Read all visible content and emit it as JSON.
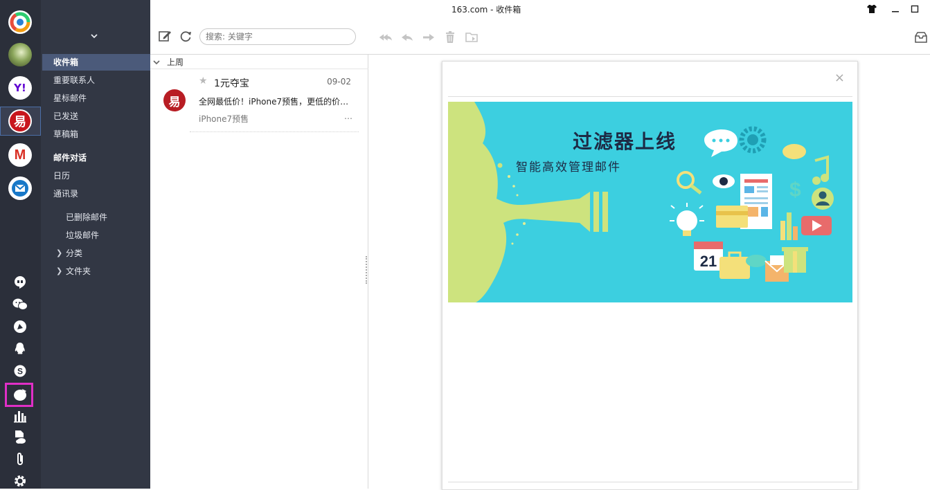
{
  "window": {
    "title": "163.com - 收件箱",
    "buttons": [
      "skin-icon",
      "minimize-icon",
      "maximize-icon"
    ]
  },
  "accounts": [
    {
      "name": "app-logo",
      "color": "#ffffff"
    },
    {
      "name": "user-photo-account",
      "color": "#6d8a3f"
    },
    {
      "name": "yahoo-account",
      "label": "Y!",
      "color": "#6001d2"
    },
    {
      "name": "netease-163-account",
      "label": "易",
      "color": "#c8161d",
      "selected": true
    },
    {
      "name": "gmail-account",
      "label": "M",
      "color": "#d93025"
    },
    {
      "name": "outlook-account",
      "label": "⊠",
      "color": "#1878c8"
    }
  ],
  "tools": [
    "hangouts-icon",
    "wechat-icon",
    "messenger-icon",
    "qq-icon",
    "skype-icon",
    "evernote-icon",
    "stats-icon",
    "cloud-files-icon",
    "attachments-icon",
    "settings-icon"
  ],
  "folders": {
    "primary": [
      {
        "label": "收件箱",
        "selected": true
      },
      {
        "label": "重要联系人"
      },
      {
        "label": "星标邮件"
      },
      {
        "label": "已发送"
      },
      {
        "label": "草稿箱"
      }
    ],
    "secondary": [
      {
        "label": "邮件对话",
        "bold": true
      },
      {
        "label": "日历"
      },
      {
        "label": "通讯录"
      }
    ],
    "tertiary": [
      {
        "label": "已删除邮件"
      },
      {
        "label": "垃圾邮件"
      },
      {
        "label": "分类",
        "expandable": true
      },
      {
        "label": "文件夹",
        "expandable": true
      }
    ]
  },
  "toolbar": {
    "search_placeholder": "搜索: 关键字"
  },
  "message_list": {
    "group_label": "上周",
    "messages": [
      {
        "sender": "1元夺宝",
        "date": "09-02",
        "subject": "全网最低价！iPhone7预售，更低的价…",
        "preview": "iPhone7预售",
        "more": "…",
        "avatar_label": "易"
      }
    ]
  },
  "reader": {
    "close_label": "×",
    "banner_title": "过滤器上线",
    "banner_subtitle": "智能高效管理邮件",
    "calendar_day": "21"
  },
  "colors": {
    "rail_bg": "#2b2f3a",
    "folder_bg": "#323744",
    "selected_folder": "#4b5a7a",
    "banner_bg": "#3ccfe0",
    "highlight": "#e02fc6"
  }
}
